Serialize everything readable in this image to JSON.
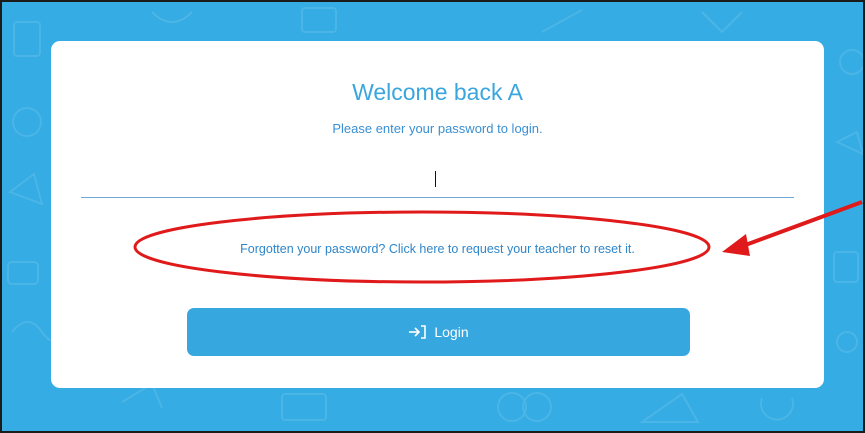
{
  "login_card": {
    "title": "Welcome back A",
    "subtitle": "Please enter your password to login.",
    "password_value": "",
    "forgot_link": "Forgotten your password? Click here to request your teacher to reset it.",
    "login_button_label": "Login",
    "login_icon": "sign-in-icon"
  },
  "colors": {
    "background": "#35ace3",
    "accent": "#37a7df",
    "annotation": "#e01a1a"
  },
  "annotation": {
    "shapes": [
      "ellipse",
      "arrow"
    ]
  }
}
